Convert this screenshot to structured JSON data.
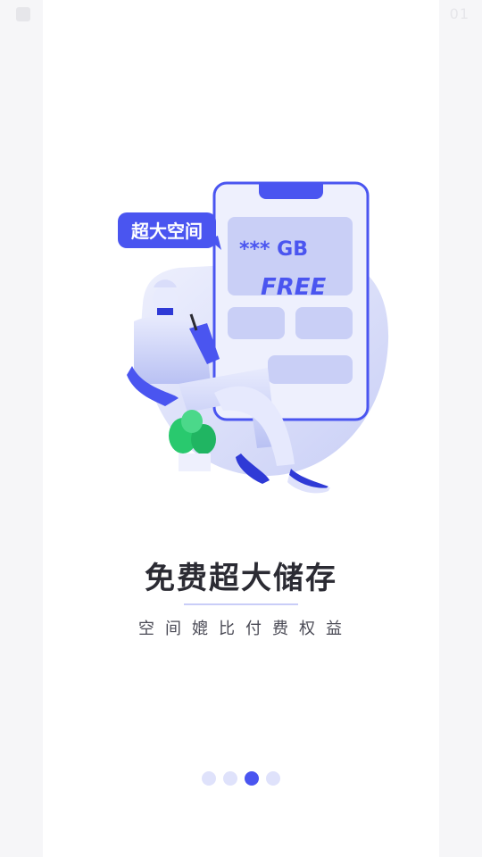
{
  "status_bar": {
    "time_fragment": "01"
  },
  "illustration": {
    "badge_text": "超大空间",
    "storage_text": "*** GB",
    "free_text": "FREE"
  },
  "title": "免费超大储存",
  "subtitle": "空间媲比付费权益",
  "pager": {
    "count": 4,
    "active_index": 2
  },
  "colors": {
    "accent": "#4a55f0",
    "accent_light": "#dfe2fb",
    "title": "#2b2b33"
  }
}
